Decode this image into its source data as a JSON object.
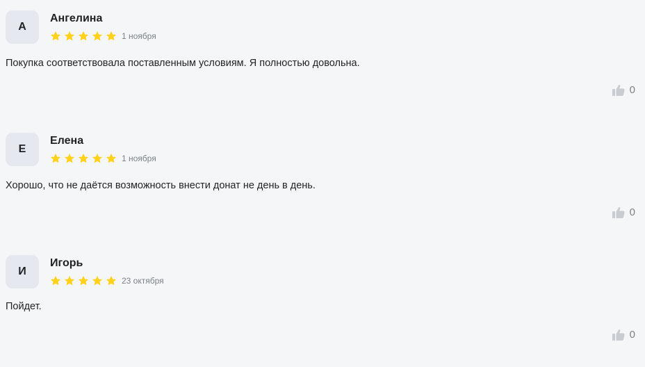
{
  "reviews": [
    {
      "initial": "А",
      "author": "Ангелина",
      "rating": 5,
      "date": "1 ноября",
      "text": "Покупка соответствовала поставленным условиям. Я полностью довольна.",
      "likes": "0"
    },
    {
      "initial": "Е",
      "author": "Елена",
      "rating": 5,
      "date": "1 ноября",
      "text": "Хорошо, что не даётся возможность внести донат не день в день.",
      "likes": "0"
    },
    {
      "initial": "И",
      "author": "Игорь",
      "rating": 5,
      "date": "23 октября",
      "text": "Пойдет.",
      "likes": "0"
    }
  ],
  "colors": {
    "star": "#ffd11a",
    "like_icon": "#c9ccd1",
    "avatar_bg": "#e5e8ef",
    "background": "#f5f6f8"
  },
  "icons": {
    "star": "star-icon",
    "like": "thumbs-up-icon"
  }
}
